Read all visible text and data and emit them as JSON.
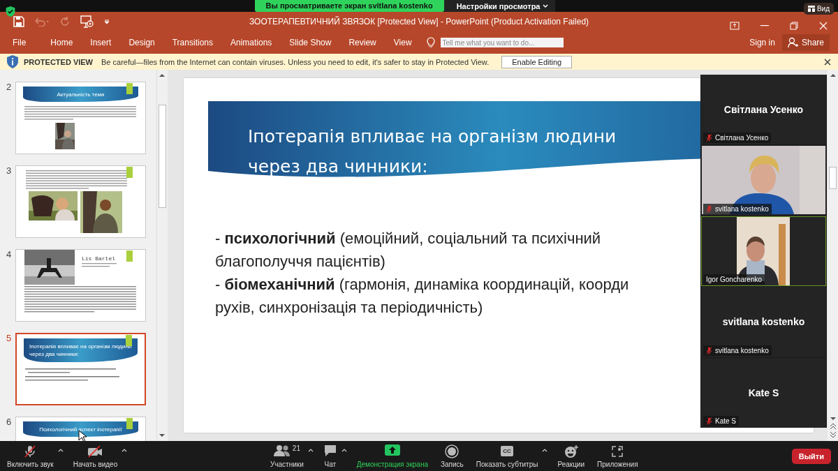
{
  "zoom_banner": {
    "sharing": "Вы просматриваете экран svitlana kostenko",
    "view_options": "Настройки просмотра",
    "view_button": "Вид"
  },
  "window": {
    "title": "ЗООТЕРАПЕВТИЧНИЙ ЗВЯЗОК [Protected View] - PowerPoint (Product Activation Failed)"
  },
  "ribbon": {
    "tabs": [
      "File",
      "Home",
      "Insert",
      "Design",
      "Transitions",
      "Animations",
      "Slide Show",
      "Review",
      "View"
    ],
    "search": {
      "placeholder": "Tell me what you want to do..."
    },
    "sign_in": "Sign in",
    "share": "Share"
  },
  "protected_view": {
    "label": "PROTECTED VIEW",
    "message": "Be careful—files from the Internet can contain viruses. Unless you need to edit, it's safer to stay in Protected View.",
    "button": "Enable Editing"
  },
  "slides": [
    {
      "number": "2",
      "kind": "title-text-photo",
      "title": "Актуальність теми",
      "selected": false
    },
    {
      "number": "3",
      "kind": "text-photos",
      "selected": false
    },
    {
      "number": "4",
      "kind": "photo-caption",
      "caption": "Lis Bartel",
      "selected": false
    },
    {
      "number": "5",
      "kind": "title-bullets",
      "title": "Іпотерапія впливає на організм людини через два чинники:",
      "selected": true
    },
    {
      "number": "6",
      "kind": "title-only",
      "title": "Психологічний аспект іпотерапії",
      "selected": false
    }
  ],
  "current_slide": {
    "title_lines": [
      "Іпотерапія впливає на організм людини",
      "через два чинники:"
    ],
    "body_lines": [
      "- **психологічний** (емоційний, соціальний та психічний",
      "благополуччя пацієнтів)",
      "- **біомеханічний** (гармонія, динаміка координацій, коорди",
      "рухів, синхронізація та періодичність)"
    ]
  },
  "participants": [
    {
      "kind": "name",
      "name": "Світлана Усенко",
      "label": "Світлана Усенко",
      "muted": true,
      "active": false
    },
    {
      "kind": "video",
      "label": "svitlana kostenko",
      "muted": true,
      "active": false
    },
    {
      "kind": "video",
      "label": "Igor Goncharenko",
      "muted": false,
      "active": true
    },
    {
      "kind": "name",
      "name": "svitlana kostenko",
      "label": "svitlana kostenko",
      "muted": true,
      "active": false
    },
    {
      "kind": "name",
      "name": "Kate S",
      "label": "Kate S",
      "muted": true,
      "active": false
    }
  ],
  "toolbar": {
    "left": [
      {
        "kind": "mic-off",
        "label": "Включить звук",
        "caret": true
      },
      {
        "kind": "video-off",
        "label": "Начать видео",
        "caret": true
      }
    ],
    "center": [
      {
        "kind": "people",
        "label": "Участники",
        "count": "21",
        "caret": true,
        "highlighted": false
      },
      {
        "kind": "chat",
        "label": "Чат",
        "caret": true,
        "highlighted": false
      },
      {
        "kind": "share",
        "label": "Демонстрация экрана",
        "caret": false,
        "highlighted": true
      },
      {
        "kind": "record",
        "label": "Запись",
        "caret": false,
        "highlighted": false
      },
      {
        "kind": "cc",
        "badge": "CC",
        "label": "Показать субтитры",
        "caret": true,
        "highlighted": false
      },
      {
        "kind": "emoji",
        "label": "Реакции",
        "caret": false,
        "highlighted": false
      },
      {
        "kind": "apps",
        "label": "Приложения",
        "caret": false,
        "highlighted": false
      }
    ],
    "leave": "Выйти"
  }
}
